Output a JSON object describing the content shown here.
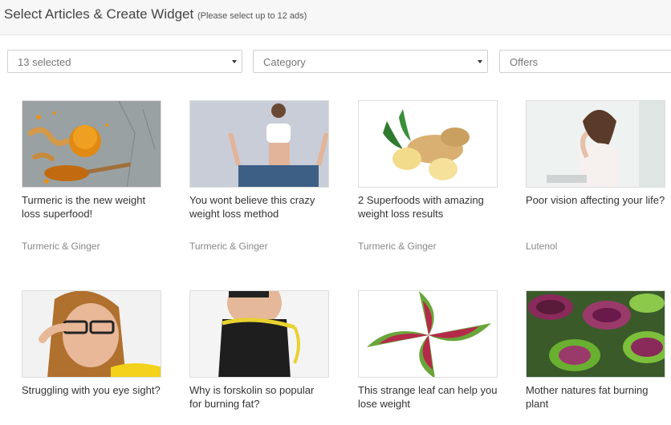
{
  "header": {
    "title": "Select Articles & Create Widget",
    "subtitle": "(Please select up to 12 ads)"
  },
  "filters": {
    "selection": "13 selected",
    "category": "Category",
    "offers": "Offers"
  },
  "articles": [
    {
      "title": "Turmeric is the new weight loss superfood!",
      "source": "Turmeric & Ginger",
      "image": "turmeric-roots-powder-image"
    },
    {
      "title": "You wont believe this crazy weight loss method",
      "source": "Turmeric & Ginger",
      "image": "woman-oversized-jeans-image"
    },
    {
      "title": "2 Superfoods with amazing weight loss results",
      "source": "Turmeric & Ginger",
      "image": "ginger-root-image"
    },
    {
      "title": "Poor vision affecting your life?",
      "source": "Lutenol",
      "image": "woman-rubbing-eyes-image"
    },
    {
      "title": "Struggling with you eye sight?",
      "source": "",
      "image": "woman-with-glasses-image"
    },
    {
      "title": "Why is forskolin so popular for burning fat?",
      "source": "",
      "image": "waist-measuring-tape-image"
    },
    {
      "title": "This strange leaf can help you lose weight",
      "source": "",
      "image": "coleus-leaf-image"
    },
    {
      "title": "Mother natures fat burning plant",
      "source": "",
      "image": "coleus-plants-image"
    }
  ]
}
